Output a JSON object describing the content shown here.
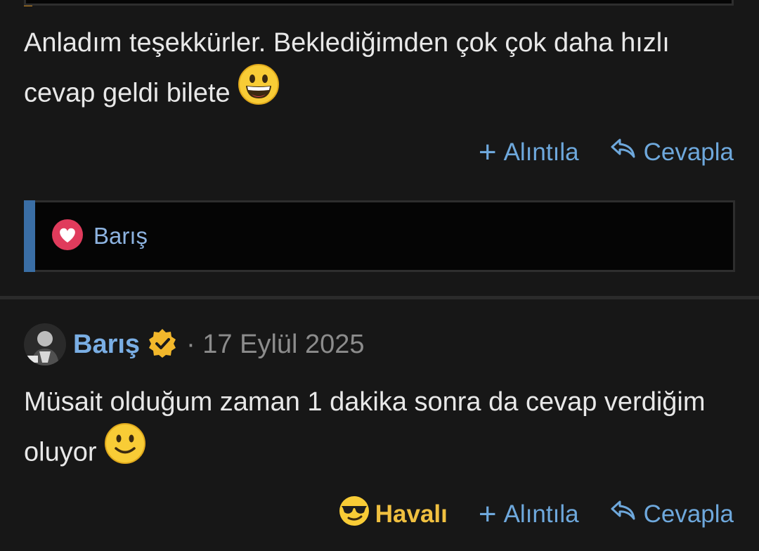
{
  "post1": {
    "text": "Anladım teşekkürler. Beklediğimden çok çok daha hızlı cevap geldi bilete",
    "emoji": "grinning-face-emoji"
  },
  "post1_actions": {
    "quote": "Alıntıla",
    "reply": "Cevapla"
  },
  "reactions": {
    "name": "Barış",
    "icon": "heart-reaction-icon"
  },
  "post2": {
    "author": "Barış",
    "separator": "·",
    "date": "17 Eylül 2025",
    "text": "Müsait olduğum zaman 1 dakika sonra da cevap verdiğim oluyor",
    "emoji": "slightly-smiling-face-emoji"
  },
  "post2_actions": {
    "reaction": "Havalı",
    "quote": "Alıntıla",
    "reply": "Cevapla"
  },
  "colors": {
    "background": "#171717",
    "link": "#6ea8dc",
    "accent_blue": "#3a6ea5",
    "accent_orange": "#d38f22",
    "reaction_yellow": "#f0c040",
    "date_gray": "#8c8c8c"
  }
}
